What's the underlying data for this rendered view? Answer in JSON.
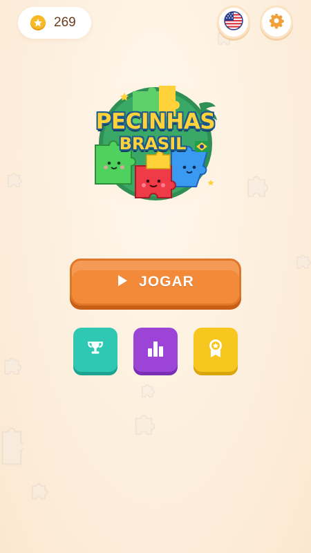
{
  "header": {
    "coins": "269",
    "language_icon": "us-flag-icon",
    "settings_icon": "gear-icon"
  },
  "logo": {
    "line1": "PECINHAS",
    "line2": "BRASIL",
    "icon": "brazil-flag-icon"
  },
  "menu": {
    "play_label": "JOGAR",
    "buttons": [
      {
        "icon": "trophy-icon",
        "color": "#2fc9b3"
      },
      {
        "icon": "bar-chart-icon",
        "color": "#9b44d6"
      },
      {
        "icon": "award-badge-icon",
        "color": "#f8c71f"
      }
    ]
  },
  "colors": {
    "play": "#f38a3a",
    "coin": "#f7b928",
    "settings": "#f1a03a"
  }
}
